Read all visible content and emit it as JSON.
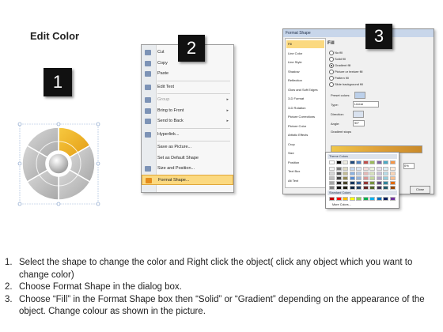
{
  "panel1": {
    "title": "Edit Color",
    "badge": "1"
  },
  "panel2": {
    "badge": "2",
    "menu": [
      {
        "label": "Cut",
        "icon": "scissors-icon",
        "arrow": false,
        "disabled": false
      },
      {
        "label": "Copy",
        "icon": "copy-icon",
        "arrow": false,
        "disabled": false
      },
      {
        "label": "Paste",
        "icon": "paste-icon",
        "arrow": false,
        "disabled": false
      },
      {
        "label": "Edit Text",
        "icon": "edit-text-icon",
        "arrow": false,
        "disabled": false,
        "sep_before": true
      },
      {
        "label": "Group",
        "icon": "group-icon",
        "arrow": true,
        "disabled": true,
        "sep_before": true
      },
      {
        "label": "Bring to Front",
        "icon": "bring-front-icon",
        "arrow": true,
        "disabled": false
      },
      {
        "label": "Send to Back",
        "icon": "send-back-icon",
        "arrow": true,
        "disabled": false
      },
      {
        "label": "Hyperlink...",
        "icon": "hyperlink-icon",
        "arrow": false,
        "disabled": false,
        "sep_before": true
      },
      {
        "label": "Save as Picture...",
        "icon": "",
        "arrow": false,
        "disabled": false,
        "sep_before": true
      },
      {
        "label": "Set as Default Shape",
        "icon": "",
        "arrow": false,
        "disabled": false
      },
      {
        "label": "Size and Position...",
        "icon": "size-position-icon",
        "arrow": false,
        "disabled": false
      },
      {
        "label": "Format Shape...",
        "icon": "format-shape-icon",
        "arrow": false,
        "disabled": false,
        "highlighted": true
      }
    ]
  },
  "panel3": {
    "badge": "3",
    "dialog_title": "Format Shape",
    "nav": [
      "Fill",
      "Line Color",
      "Line Style",
      "Shadow",
      "Reflection",
      "Glow and Soft Edges",
      "3-D Format",
      "3-D Rotation",
      "Picture Corrections",
      "Picture Color",
      "Artistic Effects",
      "Crop",
      "Size",
      "Position",
      "Text Box",
      "Alt Text"
    ],
    "nav_selected": "Fill",
    "fill_heading": "Fill",
    "fill_options": [
      {
        "label": "No fill",
        "selected": false
      },
      {
        "label": "Solid fill",
        "selected": false
      },
      {
        "label": "Gradient fill",
        "selected": true
      },
      {
        "label": "Picture or texture fill",
        "selected": false
      },
      {
        "label": "Pattern fill",
        "selected": false
      },
      {
        "label": "Slide background fill",
        "selected": false
      }
    ],
    "fields": {
      "preset_label": "Preset colors:",
      "type_label": "Type:",
      "type_value": "Linear",
      "direction_label": "Direction:",
      "angle_label": "Angle:",
      "angle_value": "90°",
      "gradient_stops_label": "Gradient stops",
      "color_label": "Color",
      "position_label": "Position:",
      "position_value": "0%",
      "brightness_label": "Brightness:",
      "transparency_label": "Transparency:",
      "rotate_label": "Rotate with shape",
      "close_label": "Close"
    },
    "palette": {
      "theme_header": "Theme Colors",
      "standard_header": "Standard Colors",
      "more_label": "More Colors...",
      "theme_top": [
        "#ffffff",
        "#000000",
        "#eeece1",
        "#1f497d",
        "#4f81bd",
        "#c0504d",
        "#9bbb59",
        "#8064a2",
        "#4bacc6",
        "#f79646"
      ],
      "theme_shades": [
        [
          "#f2f2f2",
          "#7f7f7f",
          "#ddd9c3",
          "#c6d9f0",
          "#dbe5f1",
          "#f2dcdb",
          "#ebf1dd",
          "#e5e0ec",
          "#dbeef3",
          "#fdeada"
        ],
        [
          "#d8d8d8",
          "#595959",
          "#c4bd97",
          "#8db3e2",
          "#b8cce4",
          "#e5b9b7",
          "#d7e3bc",
          "#ccc1d9",
          "#b7dde8",
          "#fbd5b5"
        ],
        [
          "#bfbfbf",
          "#3f3f3f",
          "#938953",
          "#548dd4",
          "#95b3d7",
          "#d99694",
          "#c3d69b",
          "#b2a2c7",
          "#92cddc",
          "#fac08f"
        ],
        [
          "#a5a5a5",
          "#262626",
          "#494429",
          "#17365d",
          "#366092",
          "#953734",
          "#76923c",
          "#5f497a",
          "#31859b",
          "#e36c09"
        ],
        [
          "#7f7f7f",
          "#0c0c0c",
          "#1d1b10",
          "#0f243e",
          "#244061",
          "#632423",
          "#4f6128",
          "#3f3151",
          "#205867",
          "#974806"
        ]
      ],
      "standard": [
        "#c00000",
        "#ff0000",
        "#ffc000",
        "#ffff00",
        "#92d050",
        "#00b050",
        "#00b0f0",
        "#0070c0",
        "#002060",
        "#7030a0"
      ]
    }
  },
  "instructions": [
    {
      "num": "1.",
      "text": "Select the shape to change the color and Right click the object( click any object which you want to change color)"
    },
    {
      "num": "2.",
      "text": "Choose Format Shape in the dialog box."
    },
    {
      "num": "3.",
      "text": "Choose “Fill” in the Format Shape box then “Solid” or “Gradient” depending on the appearance of the object. Change colour as shown in the picture."
    }
  ],
  "colors": {
    "accent": "#f0b321",
    "highlight": "#fbd980",
    "wheel_gray": "#b8b8b8"
  }
}
